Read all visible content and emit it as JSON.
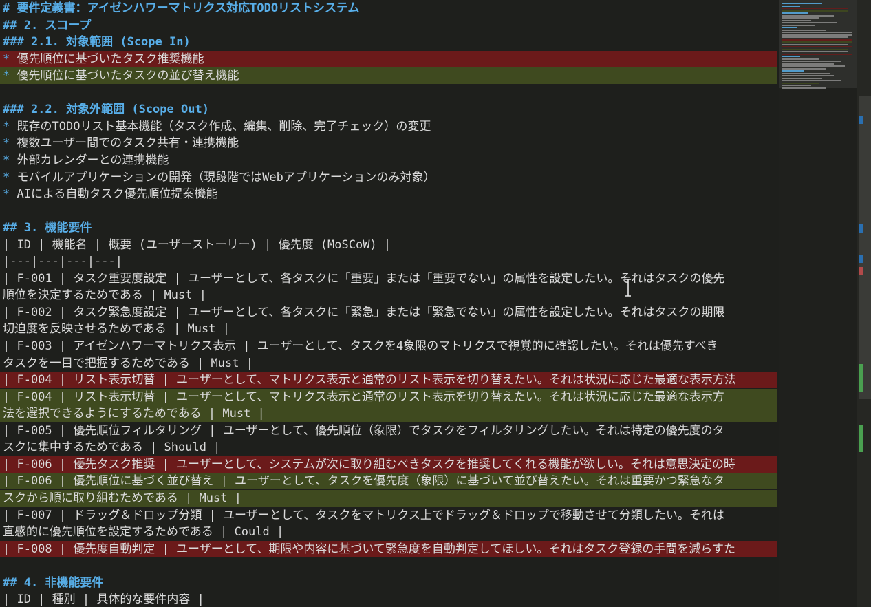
{
  "colors": {
    "background": "#1e1f1c",
    "heading": "#58aee8",
    "text": "#dadada",
    "removed_line": "#6b1a1a",
    "added_line": "#3f4a1f"
  },
  "editor": {
    "lines": [
      {
        "kind": "normal",
        "segs": [
          [
            "h",
            "# 要件定義書：アイゼンハワーマトリクス対応TODOリストシステム"
          ]
        ]
      },
      {
        "kind": "normal",
        "segs": [
          [
            "h",
            "## 2. スコープ"
          ]
        ]
      },
      {
        "kind": "normal",
        "segs": [
          [
            "h",
            "### 2.1. 対象範囲 (Scope In)"
          ]
        ]
      },
      {
        "kind": "del",
        "segs": [
          [
            "b",
            "* "
          ],
          [
            "t",
            "優先順位に基づいたタスク推奨機能"
          ]
        ]
      },
      {
        "kind": "add",
        "segs": [
          [
            "b",
            "* "
          ],
          [
            "t",
            "優先順位に基づいたタスクの並び替え機能"
          ]
        ]
      },
      {
        "kind": "normal",
        "segs": [
          [
            "t",
            ""
          ]
        ]
      },
      {
        "kind": "normal",
        "segs": [
          [
            "h",
            "### 2.2. 対象外範囲 (Scope Out)"
          ]
        ]
      },
      {
        "kind": "normal",
        "segs": [
          [
            "b",
            "* "
          ],
          [
            "t",
            "既存のTODOリスト基本機能（タスク作成、編集、削除、完了チェック）の変更"
          ]
        ]
      },
      {
        "kind": "normal",
        "segs": [
          [
            "b",
            "* "
          ],
          [
            "t",
            "複数ユーザー間でのタスク共有・連携機能"
          ]
        ]
      },
      {
        "kind": "normal",
        "segs": [
          [
            "b",
            "* "
          ],
          [
            "t",
            "外部カレンダーとの連携機能"
          ]
        ]
      },
      {
        "kind": "normal",
        "segs": [
          [
            "b",
            "* "
          ],
          [
            "t",
            "モバイルアプリケーションの開発（現段階ではWebアプリケーションのみ対象）"
          ]
        ]
      },
      {
        "kind": "normal",
        "segs": [
          [
            "b",
            "* "
          ],
          [
            "t",
            "AIによる自動タスク優先順位提案機能"
          ]
        ]
      },
      {
        "kind": "normal",
        "segs": [
          [
            "t",
            ""
          ]
        ]
      },
      {
        "kind": "normal",
        "segs": [
          [
            "h",
            "## 3. 機能要件"
          ]
        ]
      },
      {
        "kind": "normal",
        "segs": [
          [
            "t",
            "| ID | 機能名 | 概要 (ユーザーストーリー) | 優先度 (MoSCoW) |"
          ]
        ]
      },
      {
        "kind": "normal",
        "segs": [
          [
            "t",
            "|---|---|---|---|"
          ]
        ]
      },
      {
        "kind": "normal",
        "segs": [
          [
            "t",
            "| F-001 | タスク重要度設定 | ユーザーとして、各タスクに「重要」または「重要でない」の属性を設定したい。それはタスクの優先"
          ]
        ]
      },
      {
        "kind": "normal",
        "segs": [
          [
            "t",
            "順位を決定するためである | Must |"
          ]
        ]
      },
      {
        "kind": "normal",
        "segs": [
          [
            "t",
            "| F-002 | タスク緊急度設定 | ユーザーとして、各タスクに「緊急」または「緊急でない」の属性を設定したい。それはタスクの期限"
          ]
        ]
      },
      {
        "kind": "normal",
        "segs": [
          [
            "t",
            "切迫度を反映させるためである | Must |"
          ]
        ]
      },
      {
        "kind": "normal",
        "segs": [
          [
            "t",
            "| F-003 | アイゼンハワーマトリクス表示 | ユーザーとして、タスクを4象限のマトリクスで視覚的に確認したい。それは優先すべき"
          ]
        ]
      },
      {
        "kind": "normal",
        "segs": [
          [
            "t",
            "タスクを一目で把握するためである | Must |"
          ]
        ]
      },
      {
        "kind": "del",
        "segs": [
          [
            "t",
            "| F-004 | リスト表示切替 | ユーザーとして、マトリクス表示と通常のリスト表示を切り替えたい。それは状況に応じた最適な表示方法"
          ]
        ]
      },
      {
        "kind": "add",
        "segs": [
          [
            "t",
            "| F-004 | リスト表示切替 | ユーザーとして、マトリクス表示と通常のリスト表示を切り替えたい。それは状況に応じた最適な表示方"
          ]
        ]
      },
      {
        "kind": "add",
        "segs": [
          [
            "t",
            "法を選択できるようにするためである | Must |"
          ]
        ]
      },
      {
        "kind": "normal",
        "segs": [
          [
            "t",
            "| F-005 | 優先順位フィルタリング | ユーザーとして、優先順位（象限）でタスクをフィルタリングしたい。それは特定の優先度のタ"
          ]
        ]
      },
      {
        "kind": "normal",
        "segs": [
          [
            "t",
            "スクに集中するためである | Should |"
          ]
        ]
      },
      {
        "kind": "del",
        "segs": [
          [
            "t",
            "| F-006 | 優先タスク推奨 | ユーザーとして、システムが次に取り組むべきタスクを推奨してくれる機能が欲しい。それは意思決定の時"
          ]
        ]
      },
      {
        "kind": "add",
        "segs": [
          [
            "t",
            "| F-006 | 優先順位に基づく並び替え | ユーザーとして、タスクを優先度（象限）に基づいて並び替えたい。それは重要かつ緊急なタ"
          ]
        ]
      },
      {
        "kind": "add",
        "segs": [
          [
            "t",
            "スクから順に取り組むためである | Must |"
          ]
        ]
      },
      {
        "kind": "normal",
        "segs": [
          [
            "t",
            "| F-007 | ドラッグ＆ドロップ分類 | ユーザーとして、タスクをマトリクス上でドラッグ＆ドロップで移動させて分類したい。それは"
          ]
        ]
      },
      {
        "kind": "normal",
        "segs": [
          [
            "t",
            "直感的に優先順位を設定するためである | Could |"
          ]
        ]
      },
      {
        "kind": "del",
        "segs": [
          [
            "t",
            "| F-008 | 優先度自動判定 | ユーザーとして、期限や内容に基づいて緊急度を自動判定してほしい。それはタスク登録の手間を減らすた"
          ]
        ]
      },
      {
        "kind": "normal",
        "segs": [
          [
            "t",
            ""
          ]
        ]
      },
      {
        "kind": "normal",
        "segs": [
          [
            "h",
            "## 4. 非機能要件"
          ]
        ]
      },
      {
        "kind": "normal",
        "segs": [
          [
            "t",
            "| ID | 種別 | 具体的な要件内容 |"
          ]
        ]
      },
      {
        "kind": "normal",
        "segs": [
          [
            "t",
            "|---|---|---|"
          ]
        ]
      }
    ]
  },
  "minimap": {
    "lines": [
      {
        "c": "#58aee8",
        "w": 0.55
      },
      {
        "c": "#58aee8",
        "w": 0.25
      },
      {
        "c": "#6b1a1a",
        "w": 0.9
      },
      {
        "c": "#3f4a1f",
        "w": 0.9
      },
      {
        "c": "#58aee8",
        "w": 0.35
      },
      {
        "c": "#8a8a8a",
        "w": 0.7
      },
      {
        "c": "#8a8a8a",
        "w": 0.5
      },
      {
        "c": "#8a8a8a",
        "w": 0.4
      },
      {
        "c": "#8a8a8a",
        "w": 0.75
      },
      {
        "c": "#8a8a8a",
        "w": 0.45
      },
      {
        "c": "#58aee8",
        "w": 0.2
      },
      {
        "c": "#8a8a8a",
        "w": 0.6
      },
      {
        "c": "#8a8a8a",
        "w": 0.95
      },
      {
        "c": "#8a8a8a",
        "w": 0.95
      },
      {
        "c": "#8a8a8a",
        "w": 0.9
      },
      {
        "c": "#6b1a1a",
        "w": 0.95
      },
      {
        "c": "#3f4a1f",
        "w": 0.95
      },
      {
        "c": "#8a8a8a",
        "w": 0.9
      },
      {
        "c": "#6b1a1a",
        "w": 0.95
      },
      {
        "c": "#3f4a1f",
        "w": 0.9
      },
      {
        "c": "#8a8a8a",
        "w": 0.9
      },
      {
        "c": "#6b1a1a",
        "w": 0.95
      },
      {
        "c": "#58aee8",
        "w": 0.25
      },
      {
        "c": "#8a8a8a",
        "w": 0.5
      },
      {
        "c": "#8a8a8a",
        "w": 0.8
      },
      {
        "c": "#8a8a8a",
        "w": 0.7
      },
      {
        "c": "#8a8a8a",
        "w": 0.85
      },
      {
        "c": "#8a8a8a",
        "w": 0.6
      },
      {
        "c": "#58aee8",
        "w": 0.3
      },
      {
        "c": "#8a8a8a",
        "w": 0.65
      },
      {
        "c": "#8a8a8a",
        "w": 0.7
      },
      {
        "c": "#8a8a8a",
        "w": 0.55
      },
      {
        "c": "#8a8a8a",
        "w": 0.8
      },
      {
        "c": "#3f4a1f",
        "w": 0.5
      },
      {
        "c": "#8a8a8a",
        "w": 0.4
      },
      {
        "c": "#8a8a8a",
        "w": 0.6
      }
    ]
  },
  "scrollbar": {
    "marks": [
      {
        "c": "#2a6fb0",
        "pos": 0.19
      },
      {
        "c": "#2a6fb0",
        "pos": 0.37
      },
      {
        "c": "#2a6fb0",
        "pos": 0.42
      },
      {
        "c": "#b24a4a",
        "pos": 0.44
      },
      {
        "c": "#4aa050",
        "pos": 0.6
      },
      {
        "c": "#4aa050",
        "pos": 0.7
      }
    ]
  }
}
